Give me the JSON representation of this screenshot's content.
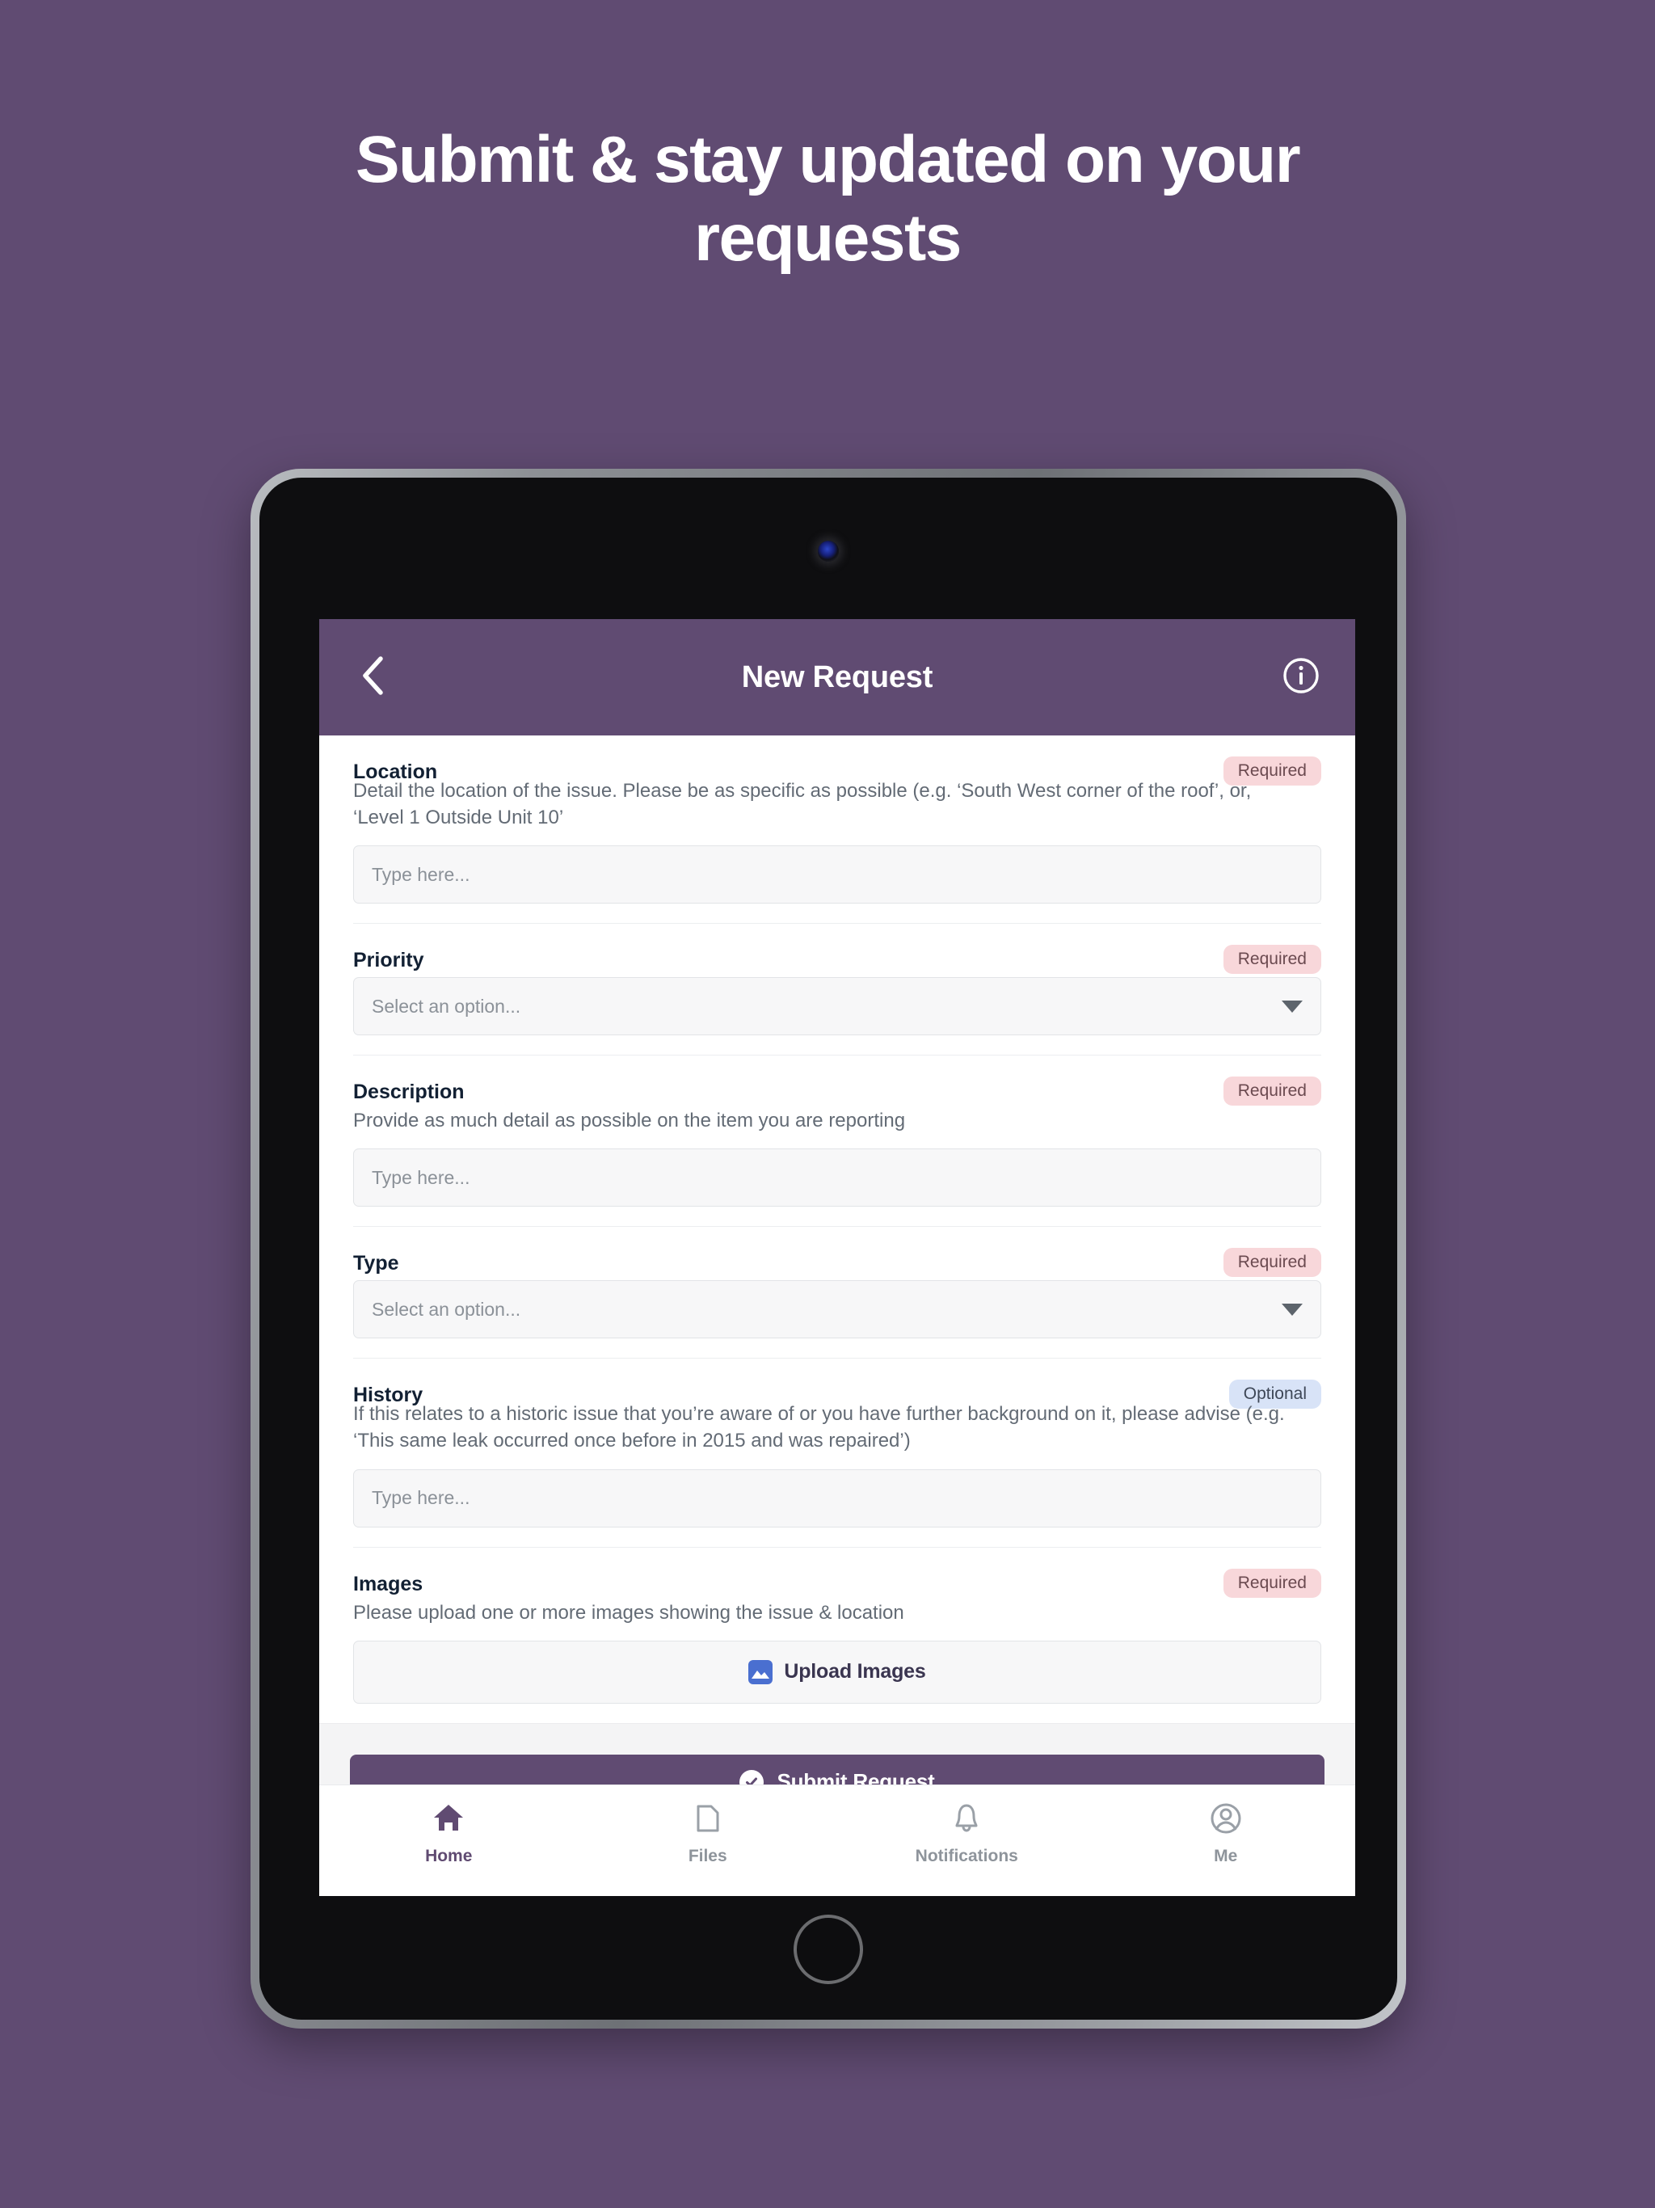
{
  "marketing": {
    "headline": "Submit & stay updated on your requests"
  },
  "appbar": {
    "title": "New Request",
    "back_icon": "chevron-left-icon",
    "info_icon": "info-circle-icon"
  },
  "form": {
    "fields": [
      {
        "label": "Location",
        "badge": "Required",
        "badge_type": "required",
        "help": "Detail the location of the issue. Please be as specific as possible (e.g. ‘South West corner of the roof’, or, ‘Level 1 Outside Unit 10’",
        "control": "text",
        "placeholder": "Type here..."
      },
      {
        "label": "Priority",
        "badge": "Required",
        "badge_type": "required",
        "help": "",
        "control": "select",
        "placeholder": "Select an option..."
      },
      {
        "label": "Description",
        "badge": "Required",
        "badge_type": "required",
        "help": "Provide as much detail as possible on the item you are reporting",
        "control": "text",
        "placeholder": "Type here..."
      },
      {
        "label": "Type",
        "badge": "Required",
        "badge_type": "required",
        "help": "",
        "control": "select",
        "placeholder": "Select an option..."
      },
      {
        "label": "History",
        "badge": "Optional",
        "badge_type": "optional",
        "help": "If this relates to a historic issue that you’re aware of or you have further background on it, please advise (e.g. ‘This same leak occurred once before in 2015 and was repaired’)",
        "control": "text",
        "placeholder": "Type here..."
      },
      {
        "label": "Images",
        "badge": "Required",
        "badge_type": "required",
        "help": "Please upload one or more images showing the issue & location",
        "control": "upload",
        "upload_label": "Upload Images",
        "upload_icon": "image-icon"
      }
    ]
  },
  "submit": {
    "label": "Submit Request",
    "icon": "check-circle-icon"
  },
  "tabbar": {
    "items": [
      {
        "label": "Home",
        "icon": "home-icon",
        "active": true
      },
      {
        "label": "Files",
        "icon": "folder-icon",
        "active": false
      },
      {
        "label": "Notifications",
        "icon": "bell-icon",
        "active": false
      },
      {
        "label": "Me",
        "icon": "person-icon",
        "active": false
      }
    ]
  },
  "colors": {
    "brand_purple": "#604b72",
    "required_badge_bg": "#f8d7da",
    "optional_badge_bg": "#d8e3f7",
    "upload_icon_blue": "#4a6fd0",
    "page_background": "#604b72"
  }
}
